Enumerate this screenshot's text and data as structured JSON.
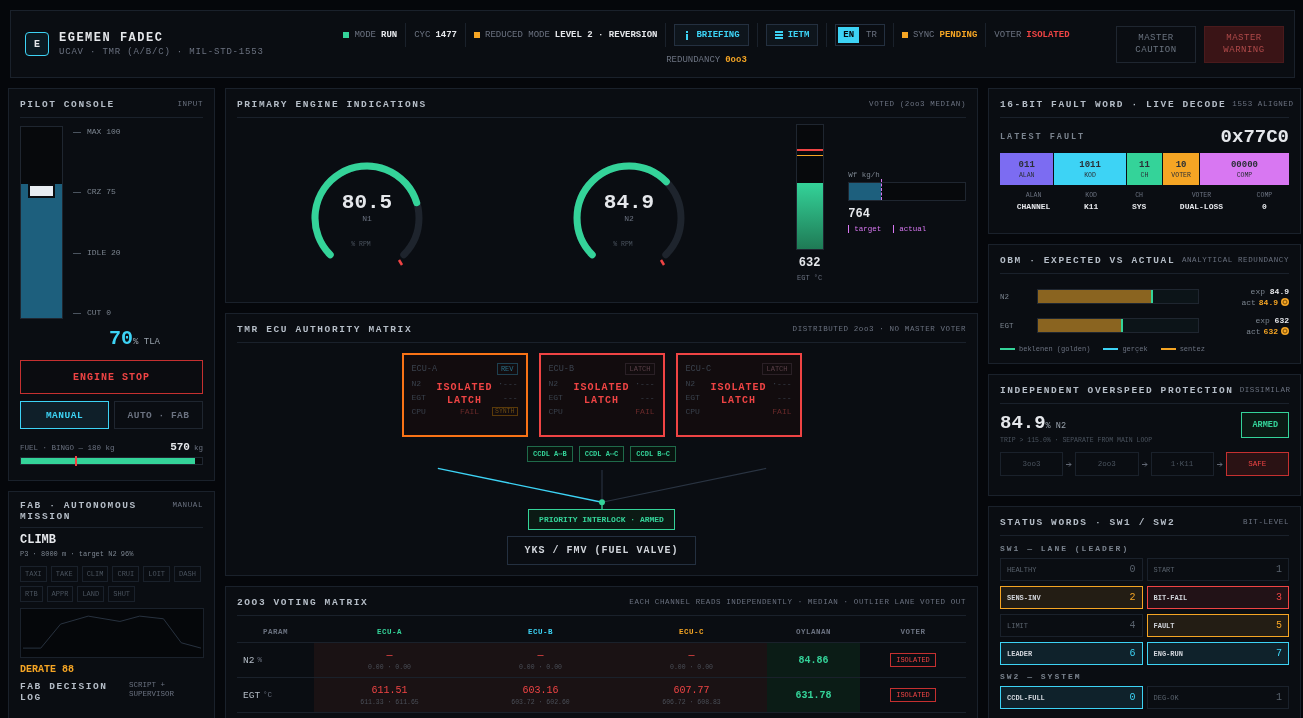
{
  "header": {
    "logo": "E",
    "title": "EGEMEN FADEC",
    "subtitle": "UCAV · TMR (A/B/C) · MIL-STD-1553",
    "status": [
      {
        "kind": "dot",
        "color": "#34d399",
        "label": "MODE",
        "value": "RUN",
        "warning": false,
        "alarm": false
      },
      {
        "kind": "plain",
        "label": "CYC",
        "value": "1477",
        "warning": false,
        "alarm": false
      },
      {
        "kind": "dot",
        "color": "#f5a524",
        "label": "REDUCED MODE",
        "value": "LEVEL 2 · REVERSION",
        "warning": false,
        "alarm": false
      },
      {
        "kind": "infobutton",
        "label": "BRIEFING"
      },
      {
        "kind": "listbutton",
        "label": "IETM"
      },
      {
        "kind": "lang",
        "options": [
          {
            "label": "EN",
            "selected": true
          },
          {
            "label": "TR",
            "selected": false
          }
        ]
      },
      {
        "kind": "dot",
        "color": "#f5a524",
        "label": "SYNC",
        "value": "PENDING",
        "warning": true,
        "alarm": false
      },
      {
        "kind": "plain",
        "label": "VOTER",
        "value": "ISOLATED",
        "warning": false,
        "alarm": true
      }
    ],
    "redundancy": {
      "label": "REDUNDANCY",
      "value": "0oo3"
    },
    "alarms": [
      {
        "label": "MASTER CAUTION",
        "on": false
      },
      {
        "label": "MASTER WARNING",
        "on": true
      }
    ]
  },
  "pilot": {
    "title": "PILOT CONSOLE",
    "tag": "INPUT",
    "throttle": {
      "level": 0.7,
      "ticks": [
        "MAX 100",
        "CRZ 75",
        "IDLE 20",
        "CUT 0"
      ]
    },
    "readout": "70",
    "unit": "% TLA",
    "stop": "ENGINE STOP",
    "modes": [
      {
        "label": "MANUAL",
        "selected": true
      },
      {
        "label": "AUTO · FAB",
        "selected": false
      }
    ],
    "fuel": {
      "label": "FUEL · BINGO — 180 kg",
      "value": "570",
      "unit": "kg",
      "level": 0.96
    }
  },
  "fab": {
    "title": "FAB · AUTONOMOUS MISSION",
    "tag": "MANUAL",
    "phase": "CLIMB",
    "detail": "P3 · 8000 m · target N2 96%",
    "phases": [
      "TAXI",
      "TAKE",
      "CLIM",
      "CRUI",
      "LOIT",
      "DASH",
      "RTB",
      "APPR",
      "LAND",
      "SHUT"
    ],
    "derate": "DERATE 88",
    "log_title": "FAB DECISION LOG",
    "log_tag": "SCRIPT + SUPERVISOR"
  },
  "engine": {
    "title": "PRIMARY ENGINE INDICATIONS",
    "tag": "VOTED (2oo3 MEDIAN)",
    "gauges": [
      {
        "value": "80.5",
        "label": "N1",
        "unit": "% RPM"
      },
      {
        "value": "84.9",
        "label": "N2",
        "unit": "% RPM"
      }
    ],
    "egt": {
      "level": 0.53,
      "value": "632",
      "label": "EGT °C"
    },
    "fuel_flow": {
      "label": "Wf kg/h",
      "level": 0.27,
      "value": "764",
      "legend": [
        "target",
        "actual"
      ]
    }
  },
  "tmr": {
    "title": "TMR ECU AUTHORITY MATRIX",
    "tag": "DISTRIBUTED 2oo3 · NO MASTER VOTER",
    "ecus": [
      {
        "name": "ECU-A",
        "badge": "REV",
        "color": "#f97316",
        "overlay": "ISOLATED LATCH",
        "rows": [
          {
            "label": "N2",
            "value": "·---"
          },
          {
            "label": "EGT",
            "value": "---"
          },
          {
            "label": "CPU",
            "value": "FAIL"
          }
        ],
        "extra": "SYNTH"
      },
      {
        "name": "ECU-B",
        "badge": "LATCH",
        "color": "#ef4444",
        "overlay": "ISOLATED LATCH",
        "rows": [
          {
            "label": "N2",
            "value": "·---"
          },
          {
            "label": "EGT",
            "value": "---"
          },
          {
            "label": "CPU",
            "value": "FAIL"
          }
        ]
      },
      {
        "name": "ECU-C",
        "badge": "LATCH",
        "color": "#ef4444",
        "overlay": "ISOLATED LATCH",
        "rows": [
          {
            "label": "N2",
            "value": "·---"
          },
          {
            "label": "EGT",
            "value": "---"
          },
          {
            "label": "CPU",
            "value": "FAIL"
          }
        ]
      }
    ],
    "links": [
      "CCDL A⇔B",
      "CCDL A⇔C",
      "CCDL B⇔C"
    ],
    "interlock": "PRIORITY INTERLOCK · ARMED",
    "valve": "YKS / FMV (FUEL VALVE)"
  },
  "voting": {
    "title": "2OO3 VOTING MATRIX",
    "tag": "EACH CHANNEL READS INDEPENDENTLY · MEDIAN · OUTLIER LANE VOTED OUT",
    "columns": [
      {
        "label": "PARAM"
      },
      {
        "label": "ECU-A",
        "color": "#34d399"
      },
      {
        "label": "ECU-B",
        "color": "#3dd3f5"
      },
      {
        "label": "ECU-C",
        "color": "#f5a524"
      },
      {
        "label": "OYLANAN"
      },
      {
        "label": "VOTER"
      }
    ],
    "rows": [
      {
        "cells": [
          {
            "value": "N2",
            "unit": "%"
          },
          {
            "value": "—",
            "sub": "0.00 · 0.00"
          },
          {
            "value": "—",
            "sub": "0.00 · 0.00"
          },
          {
            "value": "—",
            "sub": "0.00 · 0.00"
          },
          {
            "value": "84.86"
          },
          {
            "value": "ISOLATED"
          }
        ]
      },
      {
        "cells": [
          {
            "value": "EGT",
            "unit": "°C"
          },
          {
            "value": "611.51",
            "sub": "611.33 · 611.65"
          },
          {
            "value": "603.16",
            "sub": "603.72 · 602.60"
          },
          {
            "value": "607.77",
            "sub": "606.72 · 608.83"
          },
          {
            "value": "631.78"
          },
          {
            "value": "ISOLATED"
          }
        ]
      }
    ]
  },
  "fault": {
    "title": "16-BIT FAULT WORD · LIVE DECODE",
    "tag": "1553 ALIGNED",
    "label": "LATEST FAULT",
    "code": "0x77C0",
    "fields": [
      {
        "bits": "011",
        "name": "ALAN",
        "color": "#7c6cf2"
      },
      {
        "bits": "1011",
        "name": "KOD",
        "color": "#3dd3f5"
      },
      {
        "bits": "11",
        "name": "CH",
        "color": "#34d399"
      },
      {
        "bits": "10",
        "name": "VOTER",
        "color": "#f5a524"
      },
      {
        "bits": "00000",
        "name": "COMP",
        "color": "#d877f2"
      }
    ],
    "decode": [
      {
        "key": "ALAN",
        "value": "CHANNEL"
      },
      {
        "key": "KOD",
        "value": "K11"
      },
      {
        "key": "CH",
        "value": "SYS"
      },
      {
        "key": "VOTER",
        "value": "DUAL-LOSS"
      },
      {
        "key": "COMP",
        "value": "0"
      }
    ]
  },
  "obm": {
    "title": "OBM · EXPECTED VS ACTUAL",
    "tag": "ANALYTICAL REDUNDANCY",
    "rows": [
      {
        "label": "N2",
        "level": 0.72,
        "exp_label": "exp",
        "exp": "84.9",
        "act_label": "act",
        "act": "84.9"
      },
      {
        "label": "EGT",
        "level": 0.53,
        "exp_label": "exp",
        "exp": "632",
        "act_label": "act",
        "act": "632"
      }
    ],
    "legend": [
      {
        "label": "beklenen (golden)",
        "color": "#34d399"
      },
      {
        "label": "gerçek",
        "color": "#3dd3f5"
      },
      {
        "label": "sentez",
        "color": "#f5a524"
      }
    ]
  },
  "overspeed": {
    "title": "INDEPENDENT OVERSPEED PROTECTION",
    "tag": "DISSIMILAR",
    "value": "84.9",
    "unit": "% N2",
    "note": "TRIP > 115.0% · SEPARATE FROM MAIN LOOP",
    "status": "ARMED",
    "chain": [
      {
        "label": "3oo3",
        "active": false
      },
      {
        "label": "2oo3",
        "active": false
      },
      {
        "label": "1·K11",
        "active": false
      },
      {
        "label": "SAFE",
        "active": true
      }
    ]
  },
  "status_words": {
    "title": "STATUS WORDS · SW1 / SW2",
    "tag": "BIT-LEVEL",
    "groups": [
      {
        "title": "SW1 — LANE (LEADER)",
        "bits": [
          {
            "label": "HEALTHY",
            "bit": "0",
            "active": false
          },
          {
            "label": "START",
            "bit": "1",
            "active": false
          },
          {
            "label": "SENS-INV",
            "bit": "2",
            "active": true,
            "color": "#f5a524"
          },
          {
            "label": "BIT-FAIL",
            "bit": "3",
            "active": true,
            "color": "#ef4444"
          },
          {
            "label": "LIMIT",
            "bit": "4",
            "active": false
          },
          {
            "label": "FAULT",
            "bit": "5",
            "active": true,
            "color": "#f5a524"
          },
          {
            "label": "LEADER",
            "bit": "6",
            "active": true,
            "color": "#3dd3f5"
          },
          {
            "label": "ENG-RUN",
            "bit": "7",
            "active": true,
            "color": "#3dd3f5"
          }
        ]
      },
      {
        "title": "SW2 — SYSTEM",
        "bits": [
          {
            "label": "CCDL-FULL",
            "bit": "0",
            "active": true,
            "color": "#3dd3f5"
          },
          {
            "label": "DEG-OK",
            "bit": "1",
            "active": false
          }
        ]
      }
    ]
  }
}
